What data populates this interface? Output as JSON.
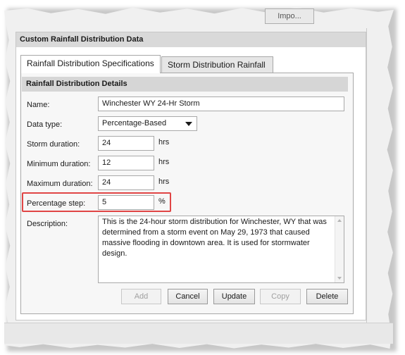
{
  "top_button": {
    "label": "Impo..."
  },
  "group": {
    "title": "Custom Rainfall Distribution Data"
  },
  "tabs": [
    {
      "label": "Rainfall Distribution Specifications",
      "active": true
    },
    {
      "label": "Storm Distribution Rainfall",
      "active": false
    }
  ],
  "panel": {
    "title": "Rainfall Distribution Details"
  },
  "fields": {
    "name": {
      "label": "Name:",
      "value": "Winchester WY 24-Hr Storm"
    },
    "data_type": {
      "label": "Data type:",
      "value": "Percentage-Based"
    },
    "storm_duration": {
      "label": "Storm duration:",
      "value": "24",
      "unit": "hrs"
    },
    "minimum_duration": {
      "label": "Minimum duration:",
      "value": "12",
      "unit": "hrs"
    },
    "maximum_duration": {
      "label": "Maximum duration:",
      "value": "24",
      "unit": "hrs"
    },
    "percentage_step": {
      "label": "Percentage step:",
      "value": "5",
      "unit": "%"
    },
    "description": {
      "label": "Description:",
      "value": "This is the 24-hour storm distribution for Winchester, WY that was determined from a storm event on May 29, 1973 that caused massive flooding in downtown area. It is used for stormwater design."
    }
  },
  "buttons": {
    "add": {
      "label": "Add",
      "enabled": false
    },
    "cancel": {
      "label": "Cancel",
      "enabled": true
    },
    "update": {
      "label": "Update",
      "enabled": true
    },
    "copy": {
      "label": "Copy",
      "enabled": false
    },
    "delete": {
      "label": "Delete",
      "enabled": true
    }
  },
  "colors": {
    "highlight": "#e04545",
    "header_bg": "#d9d9d9",
    "panel_bg": "#f7f7f7"
  }
}
